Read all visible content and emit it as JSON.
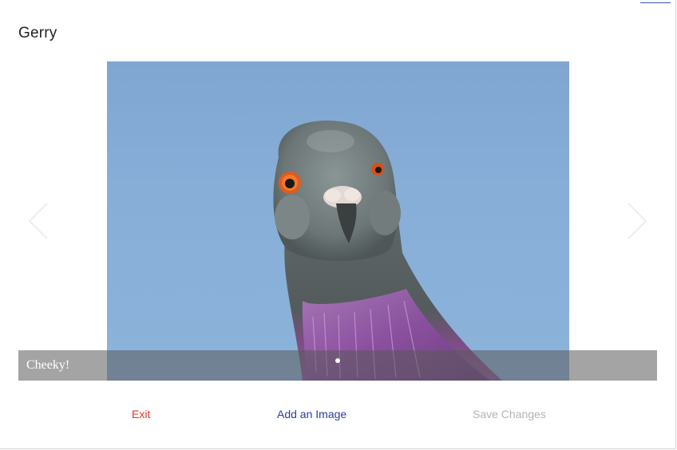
{
  "modal": {
    "title": "Gerry"
  },
  "carousel": {
    "slides": [
      {
        "caption": "Cheeky!",
        "image_subject": "pigeon"
      }
    ],
    "active_index": 0,
    "slide_count": 1
  },
  "footer": {
    "exit_label": "Exit",
    "add_image_label": "Add an Image",
    "save_label": "Save Changes"
  },
  "colors": {
    "exit": "#e3342f",
    "add_image": "#2c3e9e",
    "save_disabled": "#b4b4b4",
    "caption_bar": "rgba(90,90,90,0.55)",
    "sky": "#86aed7"
  },
  "icons": {
    "prev": "chevron-left-icon",
    "next": "chevron-right-icon"
  }
}
